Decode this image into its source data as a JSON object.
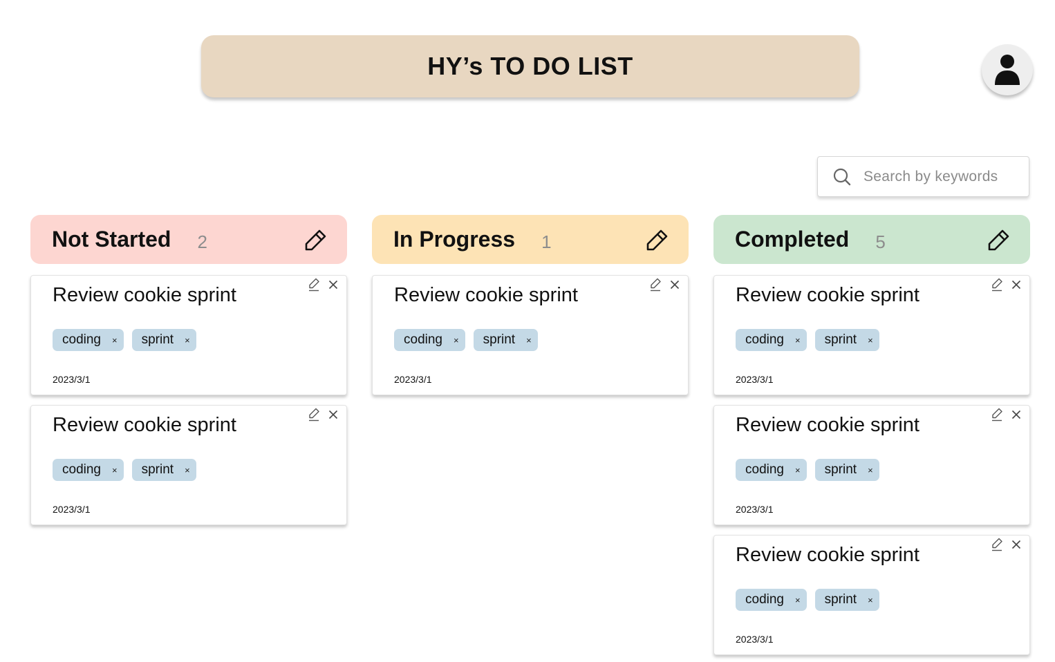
{
  "app": {
    "title": "HY’s TO DO LIST"
  },
  "search": {
    "placeholder": "Search by keywords"
  },
  "icons": {
    "avatar": "user-icon",
    "search": "search-icon",
    "edit": "pencil-icon",
    "close": "close-icon"
  },
  "columns": [
    {
      "title": "Not Started",
      "count": "2",
      "color": "#fdd6d1",
      "cards": [
        {
          "title": "Review cookie sprint",
          "tags": [
            "coding",
            "sprint"
          ],
          "date": "2023/3/1"
        },
        {
          "title": "Review cookie sprint",
          "tags": [
            "coding",
            "sprint"
          ],
          "date": "2023/3/1"
        }
      ]
    },
    {
      "title": "In Progress",
      "count": "1",
      "color": "#fde3b5",
      "cards": [
        {
          "title": "Review cookie sprint",
          "tags": [
            "coding",
            "sprint"
          ],
          "date": "2023/3/1"
        }
      ]
    },
    {
      "title": "Completed",
      "count": "5",
      "color": "#cbe6cf",
      "cards": [
        {
          "title": "Review cookie sprint",
          "tags": [
            "coding",
            "sprint"
          ],
          "date": "2023/3/1"
        },
        {
          "title": "Review cookie sprint",
          "tags": [
            "coding",
            "sprint"
          ],
          "date": "2023/3/1"
        },
        {
          "title": "Review cookie sprint",
          "tags": [
            "coding",
            "sprint"
          ],
          "date": "2023/3/1"
        }
      ]
    }
  ]
}
